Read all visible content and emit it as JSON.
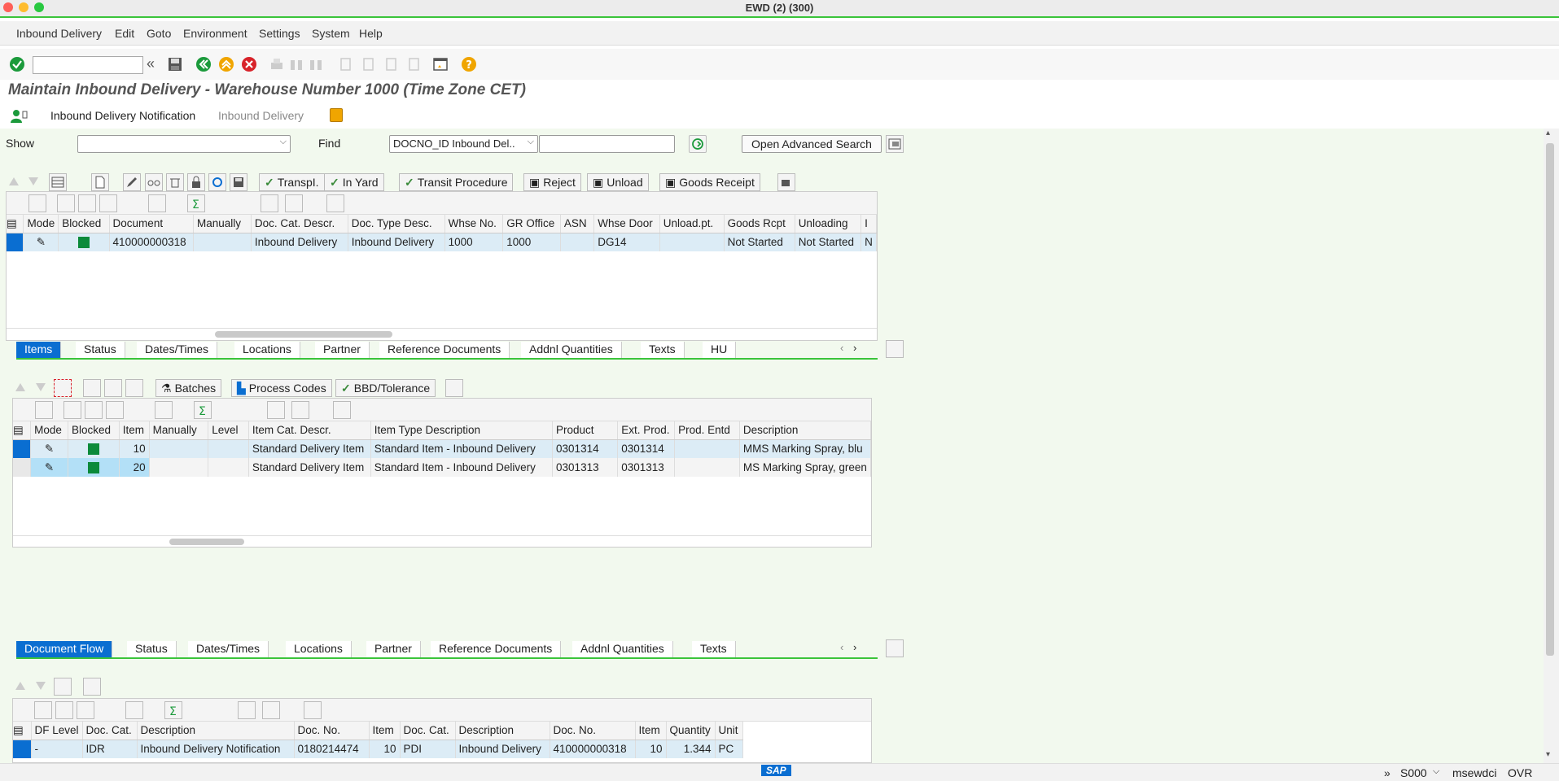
{
  "window": {
    "title": "EWD (2) (300)"
  },
  "menu": [
    "Inbound Delivery",
    "Edit",
    "Goto",
    "Environment",
    "Settings",
    "System",
    "Help"
  ],
  "page_title": "Maintain Inbound Delivery - Warehouse Number 1000 (Time Zone CET)",
  "app_links": {
    "notification": "Inbound Delivery Notification",
    "delivery": "Inbound Delivery"
  },
  "filter": {
    "show_label": "Show",
    "show_value": "",
    "find_label": "Find",
    "find_value": "DOCNO_ID  Inbound Del..",
    "find_text": "",
    "advanced_search": "Open Advanced Search"
  },
  "header_actions": [
    "TranspI.",
    "In Yard",
    "Transit Procedure",
    "Reject",
    "Unload",
    "Goods Receipt"
  ],
  "header_table": {
    "columns": [
      "Mode",
      "Blocked",
      "Document",
      "Manually",
      "Doc. Cat. Descr.",
      "Doc. Type Desc.",
      "Whse No.",
      "GR Office",
      "ASN",
      "Whse Door",
      "Unload.pt.",
      "Goods Rcpt",
      "Unloading",
      "I"
    ],
    "rows": [
      {
        "document": "410000000318",
        "manually": "",
        "doc_cat": "Inbound Delivery",
        "doc_type": "Inbound Delivery",
        "whse_no": "1000",
        "gr_office": "1000",
        "asn": "",
        "whse_door": "DG14",
        "unload_pt": "",
        "goods_rcpt": "Not Started",
        "unloading": "Not Started",
        "extra": "N"
      }
    ]
  },
  "item_tabs": [
    "Items",
    "Status",
    "Dates/Times",
    "Locations",
    "Partner",
    "Reference Documents",
    "Addnl Quantities",
    "Texts",
    "HU"
  ],
  "item_actions": [
    "Batches",
    "Process Codes",
    "BBD/Tolerance"
  ],
  "items_table": {
    "columns": [
      "Mode",
      "Blocked",
      "Item",
      "Manually",
      "Level",
      "Item Cat. Descr.",
      "Item Type Description",
      "Product",
      "Ext. Prod.",
      "Prod. Entd",
      "Description"
    ],
    "rows": [
      {
        "item": "10",
        "manually": "",
        "level": "",
        "item_cat": "Standard Delivery Item",
        "item_type": "Standard Item - Inbound Delivery",
        "product": "0301314",
        "ext_prod": "0301314",
        "prod_entd": "",
        "description": "MMS Marking Spray, blu"
      },
      {
        "item": "20",
        "manually": "",
        "level": "",
        "item_cat": "Standard Delivery Item",
        "item_type": "Standard Item - Inbound Delivery",
        "product": "0301313",
        "ext_prod": "0301313",
        "prod_entd": "",
        "description": "MS Marking Spray, green"
      }
    ]
  },
  "flow_tabs": [
    "Document Flow",
    "Status",
    "Dates/Times",
    "Locations",
    "Partner",
    "Reference Documents",
    "Addnl Quantities",
    "Texts"
  ],
  "flow_table": {
    "columns": [
      "DF Level",
      "Doc. Cat.",
      "Description",
      "Doc. No.",
      "Item",
      "Doc. Cat.",
      "Description",
      "Doc. No.",
      "Item",
      "Quantity",
      "Unit"
    ],
    "rows": [
      {
        "df_level": "-",
        "doc_cat": "IDR",
        "description": "Inbound Delivery Notification",
        "doc_no": "0180214474",
        "item": "10",
        "doc_cat2": "PDI",
        "description2": "Inbound Delivery",
        "doc_no2": "410000000318",
        "item2": "10",
        "quantity": "1.344",
        "unit": "PC"
      }
    ]
  },
  "status": {
    "sap": "SAP",
    "arrows": "»",
    "session": "S000",
    "user": "msewdci",
    "mode": "OVR"
  },
  "colors": {
    "accent": "#0a6ed1",
    "green": "#3ac43a",
    "content_bg": "#f2f9ee"
  }
}
